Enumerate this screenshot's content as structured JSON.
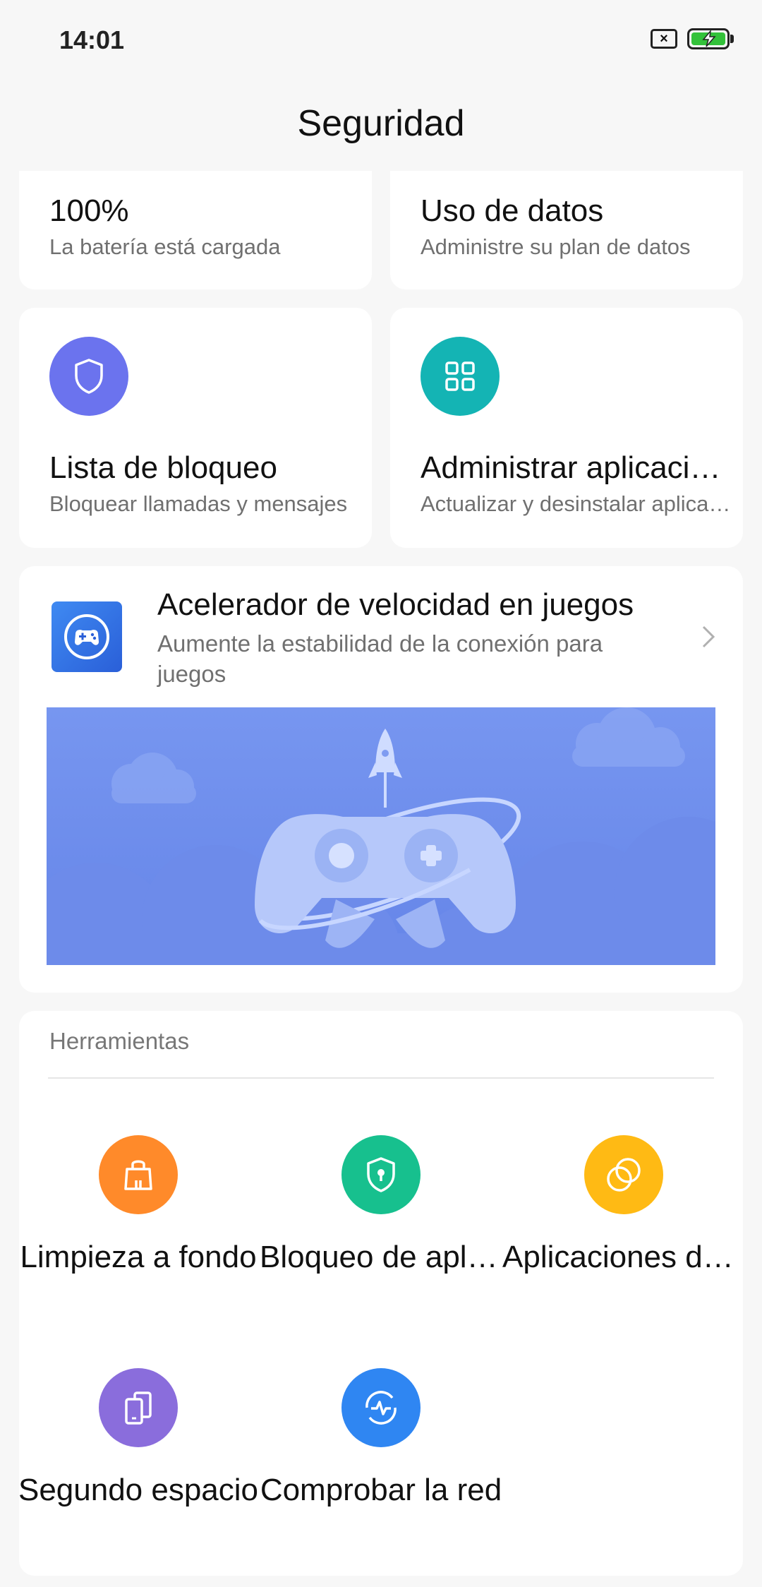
{
  "status_bar": {
    "time": "14:01",
    "sim_icon": "sim-off-icon",
    "battery_icon": "battery-charging-icon",
    "battery_color": "#33c23a"
  },
  "header": {
    "title": "Seguridad"
  },
  "cards": {
    "battery": {
      "title": "100%",
      "subtitle": "La batería está cargada"
    },
    "data_usage": {
      "title": "Uso de datos",
      "subtitle": "Administre su plan de datos"
    },
    "block_list": {
      "title": "Lista de bloqueo",
      "subtitle": "Bloquear llamadas y mensajes",
      "icon": "shield-icon",
      "icon_color": "#6b73ee"
    },
    "manage_apps": {
      "title": "Administrar aplicaciones",
      "subtitle": "Actualizar y desinstalar aplicaciones",
      "icon": "grid-icon",
      "icon_color": "#14b4b4"
    }
  },
  "game_accelerator": {
    "title": "Acelerador de velocidad en juegos",
    "subtitle": "Aumente la estabilidad de la conexión para juegos",
    "icon": "gamepad-icon",
    "chevron": "chevron-right-icon"
  },
  "tools": {
    "header": "Herramientas",
    "items": [
      {
        "label": "Limpieza a fondo",
        "icon": "cleaning-bag-icon",
        "color": "#ff8a2a"
      },
      {
        "label": "Bloqueo de aplicaciones",
        "icon": "shield-lock-icon",
        "color": "#17c08e"
      },
      {
        "label": "Aplicaciones dobles",
        "icon": "dual-circles-icon",
        "color": "#ffba14"
      },
      {
        "label": "Segundo espacio",
        "icon": "second-space-icon",
        "color": "#8a6ddc"
      },
      {
        "label": "Comprobar la red",
        "icon": "network-pulse-icon",
        "color": "#2f86f2"
      }
    ]
  }
}
